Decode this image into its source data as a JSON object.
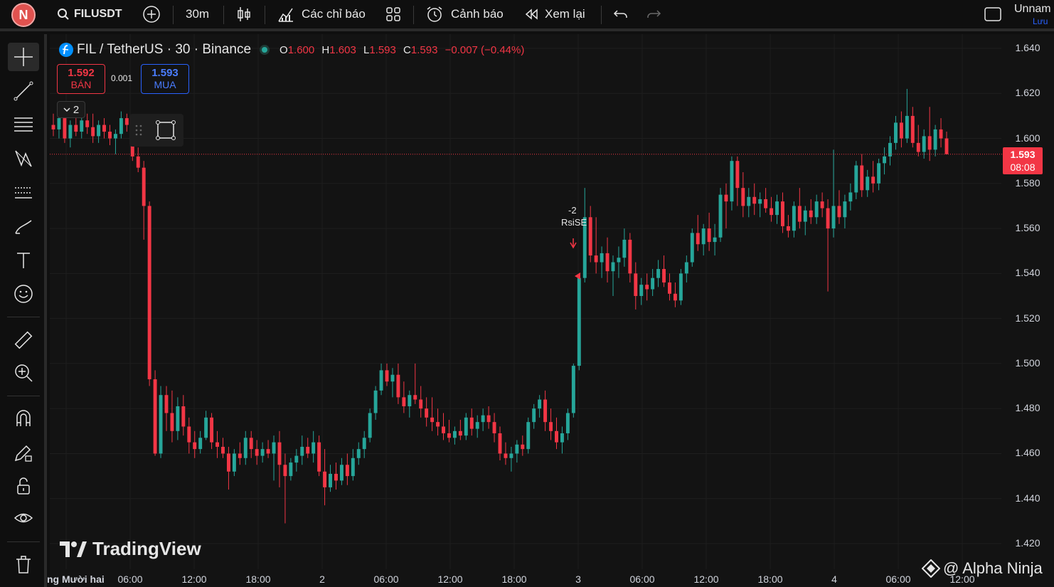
{
  "topbar": {
    "avatar_letter": "N",
    "symbol": "FILUSDT",
    "interval": "30m",
    "indicators_label": "Các chỉ báo",
    "alerts_label": "Cảnh báo",
    "replay_label": "Xem lại",
    "layout_name": "Unnam",
    "save_label": "Lưu"
  },
  "legend": {
    "title": "FIL / TetherUS · 30 · Binance",
    "o_key": "O",
    "o_val": "1.600",
    "h_key": "H",
    "h_val": "1.603",
    "l_key": "L",
    "l_val": "1.593",
    "c_key": "C",
    "c_val": "1.593",
    "change": "−0.007 (−0.44%)"
  },
  "trade": {
    "sell_price": "1.592",
    "sell_label": "BÁN",
    "spread": "0.001",
    "buy_price": "1.593",
    "buy_label": "MUA"
  },
  "collapse_count": "2",
  "price_axis": [
    "1.640",
    "1.620",
    "1.600",
    "1.580",
    "1.560",
    "1.540",
    "1.520",
    "1.500",
    "1.480",
    "1.460",
    "1.440",
    "1.420"
  ],
  "last_price": {
    "price": "1.593",
    "countdown": "08:08"
  },
  "time_axis": [
    "ng Mười hai",
    "06:00",
    "12:00",
    "18:00",
    "2",
    "06:00",
    "12:00",
    "18:00",
    "3",
    "06:00",
    "12:00",
    "18:00",
    "4",
    "06:00",
    "12:00"
  ],
  "signal": {
    "count": "-2",
    "label": "RsiSE"
  },
  "watermark": "TradingView",
  "credit": "@ Alpha Ninja",
  "colors": {
    "up": "#26a69a",
    "down": "#f23645",
    "background": "#131313"
  },
  "chart_data": {
    "type": "candlestick",
    "title": "FIL / TetherUS · 30 · Binance",
    "ylim": [
      1.42,
      1.64
    ],
    "grid": true,
    "candles": [
      [
        1.606,
        1.611,
        1.601,
        1.604
      ],
      [
        1.604,
        1.612,
        1.6,
        1.609
      ],
      [
        1.609,
        1.611,
        1.598,
        1.6
      ],
      [
        1.6,
        1.608,
        1.596,
        1.606
      ],
      [
        1.606,
        1.609,
        1.601,
        1.603
      ],
      [
        1.603,
        1.612,
        1.6,
        1.608
      ],
      [
        1.608,
        1.611,
        1.602,
        1.605
      ],
      [
        1.605,
        1.611,
        1.598,
        1.601
      ],
      [
        1.601,
        1.608,
        1.598,
        1.606
      ],
      [
        1.606,
        1.609,
        1.6,
        1.603
      ],
      [
        1.603,
        1.606,
        1.597,
        1.6
      ],
      [
        1.6,
        1.604,
        1.593,
        1.602
      ],
      [
        1.602,
        1.612,
        1.6,
        1.609
      ],
      [
        1.609,
        1.611,
        1.603,
        1.606
      ],
      [
        1.606,
        1.608,
        1.59,
        1.592
      ],
      [
        1.592,
        1.596,
        1.585,
        1.587
      ],
      [
        1.587,
        1.59,
        1.555,
        1.57
      ],
      [
        1.57,
        1.572,
        1.49,
        1.493
      ],
      [
        1.493,
        1.497,
        1.459,
        1.46
      ],
      [
        1.46,
        1.49,
        1.458,
        1.486
      ],
      [
        1.486,
        1.49,
        1.47,
        1.478
      ],
      [
        1.478,
        1.488,
        1.465,
        1.47
      ],
      [
        1.47,
        1.485,
        1.466,
        1.481
      ],
      [
        1.481,
        1.486,
        1.468,
        1.472
      ],
      [
        1.472,
        1.476,
        1.46,
        1.465
      ],
      [
        1.465,
        1.47,
        1.458,
        1.462
      ],
      [
        1.462,
        1.47,
        1.46,
        1.467
      ],
      [
        1.467,
        1.479,
        1.466,
        1.476
      ],
      [
        1.476,
        1.478,
        1.462,
        1.465
      ],
      [
        1.465,
        1.47,
        1.458,
        1.463
      ],
      [
        1.463,
        1.467,
        1.458,
        1.46
      ],
      [
        1.46,
        1.463,
        1.444,
        1.452
      ],
      [
        1.452,
        1.462,
        1.45,
        1.46
      ],
      [
        1.46,
        1.465,
        1.455,
        1.458
      ],
      [
        1.458,
        1.47,
        1.455,
        1.467
      ],
      [
        1.467,
        1.47,
        1.458,
        1.462
      ],
      [
        1.462,
        1.466,
        1.455,
        1.459
      ],
      [
        1.459,
        1.465,
        1.456,
        1.462
      ],
      [
        1.462,
        1.466,
        1.458,
        1.46
      ],
      [
        1.46,
        1.468,
        1.448,
        1.465
      ],
      [
        1.465,
        1.47,
        1.445,
        1.455
      ],
      [
        1.455,
        1.46,
        1.429,
        1.45
      ],
      [
        1.45,
        1.458,
        1.448,
        1.456
      ],
      [
        1.456,
        1.462,
        1.452,
        1.459
      ],
      [
        1.459,
        1.468,
        1.455,
        1.463
      ],
      [
        1.463,
        1.467,
        1.458,
        1.46
      ],
      [
        1.46,
        1.47,
        1.456,
        1.465
      ],
      [
        1.465,
        1.468,
        1.45,
        1.452
      ],
      [
        1.452,
        1.462,
        1.437,
        1.445
      ],
      [
        1.445,
        1.455,
        1.443,
        1.451
      ],
      [
        1.451,
        1.456,
        1.444,
        1.448
      ],
      [
        1.448,
        1.458,
        1.446,
        1.455
      ],
      [
        1.455,
        1.46,
        1.446,
        1.45
      ],
      [
        1.45,
        1.462,
        1.448,
        1.458
      ],
      [
        1.458,
        1.465,
        1.455,
        1.462
      ],
      [
        1.462,
        1.47,
        1.458,
        1.467
      ],
      [
        1.467,
        1.48,
        1.465,
        1.478
      ],
      [
        1.478,
        1.49,
        1.475,
        1.488
      ],
      [
        1.488,
        1.5,
        1.486,
        1.497
      ],
      [
        1.497,
        1.5,
        1.49,
        1.492
      ],
      [
        1.492,
        1.498,
        1.485,
        1.495
      ],
      [
        1.495,
        1.5,
        1.482,
        1.485
      ],
      [
        1.485,
        1.492,
        1.478,
        1.481
      ],
      [
        1.481,
        1.488,
        1.476,
        1.486
      ],
      [
        1.486,
        1.5,
        1.482,
        1.484
      ],
      [
        1.484,
        1.49,
        1.476,
        1.48
      ],
      [
        1.48,
        1.485,
        1.472,
        1.476
      ],
      [
        1.476,
        1.485,
        1.47,
        1.474
      ],
      [
        1.474,
        1.48,
        1.468,
        1.472
      ],
      [
        1.472,
        1.478,
        1.466,
        1.469
      ],
      [
        1.469,
        1.475,
        1.465,
        1.467
      ],
      [
        1.467,
        1.472,
        1.464,
        1.47
      ],
      [
        1.47,
        1.475,
        1.466,
        1.468
      ],
      [
        1.468,
        1.478,
        1.466,
        1.476
      ],
      [
        1.476,
        1.48,
        1.468,
        1.471
      ],
      [
        1.471,
        1.477,
        1.467,
        1.474
      ],
      [
        1.474,
        1.48,
        1.47,
        1.477
      ],
      [
        1.477,
        1.481,
        1.471,
        1.474
      ],
      [
        1.474,
        1.478,
        1.465,
        1.469
      ],
      [
        1.469,
        1.472,
        1.457,
        1.46
      ],
      [
        1.46,
        1.465,
        1.455,
        1.458
      ],
      [
        1.458,
        1.463,
        1.452,
        1.46
      ],
      [
        1.46,
        1.466,
        1.456,
        1.464
      ],
      [
        1.464,
        1.468,
        1.459,
        1.462
      ],
      [
        1.462,
        1.476,
        1.46,
        1.474
      ],
      [
        1.474,
        1.482,
        1.471,
        1.48
      ],
      [
        1.48,
        1.486,
        1.476,
        1.484
      ],
      [
        1.484,
        1.488,
        1.47,
        1.474
      ],
      [
        1.474,
        1.48,
        1.466,
        1.47
      ],
      [
        1.47,
        1.476,
        1.462,
        1.465
      ],
      [
        1.465,
        1.472,
        1.46,
        1.469
      ],
      [
        1.469,
        1.48,
        1.466,
        1.478
      ],
      [
        1.478,
        1.5,
        1.476,
        1.499
      ],
      [
        1.499,
        1.54,
        1.497,
        1.538
      ],
      [
        1.538,
        1.578,
        1.536,
        1.565
      ],
      [
        1.565,
        1.57,
        1.545,
        1.548
      ],
      [
        1.548,
        1.565,
        1.54,
        1.545
      ],
      [
        1.545,
        1.552,
        1.538,
        1.549
      ],
      [
        1.549,
        1.556,
        1.536,
        1.541
      ],
      [
        1.541,
        1.548,
        1.53,
        1.545
      ],
      [
        1.545,
        1.552,
        1.538,
        1.547
      ],
      [
        1.547,
        1.56,
        1.543,
        1.555
      ],
      [
        1.555,
        1.558,
        1.536,
        1.54
      ],
      [
        1.54,
        1.545,
        1.524,
        1.53
      ],
      [
        1.53,
        1.538,
        1.526,
        1.535
      ],
      [
        1.535,
        1.54,
        1.528,
        1.533
      ],
      [
        1.533,
        1.542,
        1.53,
        1.538
      ],
      [
        1.538,
        1.546,
        1.534,
        1.542
      ],
      [
        1.542,
        1.548,
        1.534,
        1.536
      ],
      [
        1.536,
        1.54,
        1.528,
        1.531
      ],
      [
        1.531,
        1.536,
        1.525,
        1.528
      ],
      [
        1.528,
        1.542,
        1.526,
        1.54
      ],
      [
        1.54,
        1.548,
        1.536,
        1.545
      ],
      [
        1.545,
        1.56,
        1.543,
        1.558
      ],
      [
        1.558,
        1.566,
        1.55,
        1.553
      ],
      [
        1.553,
        1.562,
        1.548,
        1.56
      ],
      [
        1.56,
        1.567,
        1.55,
        1.554
      ],
      [
        1.554,
        1.562,
        1.548,
        1.556
      ],
      [
        1.556,
        1.578,
        1.554,
        1.575
      ],
      [
        1.575,
        1.58,
        1.56,
        1.572
      ],
      [
        1.572,
        1.592,
        1.568,
        1.59
      ],
      [
        1.59,
        1.592,
        1.57,
        1.578
      ],
      [
        1.578,
        1.585,
        1.565,
        1.57
      ],
      [
        1.57,
        1.578,
        1.565,
        1.574
      ],
      [
        1.574,
        1.58,
        1.566,
        1.571
      ],
      [
        1.571,
        1.576,
        1.565,
        1.573
      ],
      [
        1.573,
        1.578,
        1.567,
        1.569
      ],
      [
        1.569,
        1.574,
        1.563,
        1.566
      ],
      [
        1.566,
        1.575,
        1.562,
        1.572
      ],
      [
        1.572,
        1.576,
        1.558,
        1.561
      ],
      [
        1.561,
        1.566,
        1.556,
        1.559
      ],
      [
        1.559,
        1.572,
        1.556,
        1.57
      ],
      [
        1.57,
        1.578,
        1.56,
        1.563
      ],
      [
        1.563,
        1.57,
        1.557,
        1.568
      ],
      [
        1.568,
        1.573,
        1.562,
        1.565
      ],
      [
        1.565,
        1.575,
        1.562,
        1.572
      ],
      [
        1.572,
        1.576,
        1.565,
        1.569
      ],
      [
        1.569,
        1.573,
        1.532,
        1.56
      ],
      [
        1.56,
        1.595,
        1.556,
        1.57
      ],
      [
        1.57,
        1.577,
        1.562,
        1.565
      ],
      [
        1.565,
        1.575,
        1.56,
        1.572
      ],
      [
        1.572,
        1.58,
        1.568,
        1.576
      ],
      [
        1.576,
        1.59,
        1.573,
        1.588
      ],
      [
        1.588,
        1.593,
        1.574,
        1.577
      ],
      [
        1.577,
        1.586,
        1.574,
        1.583
      ],
      [
        1.583,
        1.59,
        1.576,
        1.58
      ],
      [
        1.58,
        1.591,
        1.577,
        1.589
      ],
      [
        1.589,
        1.596,
        1.584,
        1.592
      ],
      [
        1.592,
        1.601,
        1.588,
        1.598
      ],
      [
        1.598,
        1.61,
        1.595,
        1.607
      ],
      [
        1.607,
        1.612,
        1.596,
        1.6
      ],
      [
        1.6,
        1.622,
        1.598,
        1.61
      ],
      [
        1.61,
        1.614,
        1.596,
        1.598
      ],
      [
        1.598,
        1.606,
        1.592,
        1.594
      ],
      [
        1.594,
        1.604,
        1.591,
        1.601
      ],
      [
        1.601,
        1.614,
        1.59,
        1.595
      ],
      [
        1.595,
        1.606,
        1.592,
        1.604
      ],
      [
        1.604,
        1.609,
        1.596,
        1.6
      ],
      [
        1.6,
        1.603,
        1.593,
        1.593
      ]
    ]
  }
}
